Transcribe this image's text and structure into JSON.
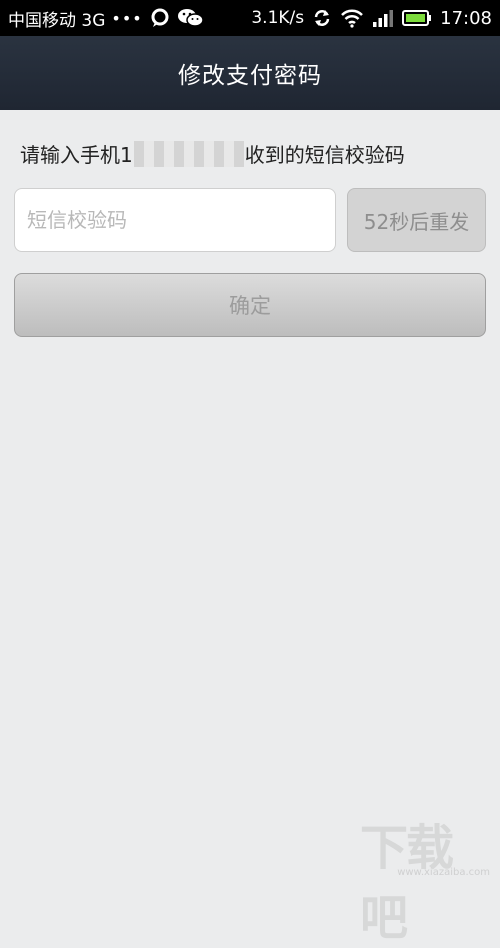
{
  "status_bar": {
    "carrier": "中国移动 3G",
    "dots": "•••",
    "speed": "3.1K/s",
    "time": "17:08",
    "icons": [
      "message-icon",
      "wechat-icon",
      "sync-icon",
      "wifi-icon",
      "signal-icon",
      "battery-icon"
    ],
    "battery_color": "#7ddc3c"
  },
  "title_bar": {
    "title": "修改支付密码"
  },
  "instruction": {
    "prefix": "请输入手机1",
    "suffix": "收到的短信校验码"
  },
  "code_input": {
    "placeholder": "短信校验码",
    "value": ""
  },
  "resend_button": {
    "label": "52秒后重发"
  },
  "confirm_button": {
    "label": "确定"
  },
  "watermark": {
    "logo": "下载吧",
    "url": "www.xiazaiba.com"
  },
  "colors": {
    "status_bar": "#000000",
    "title_bar": "#252d39",
    "background": "#ebeced",
    "button_disabled_text": "#9c9c9c"
  }
}
